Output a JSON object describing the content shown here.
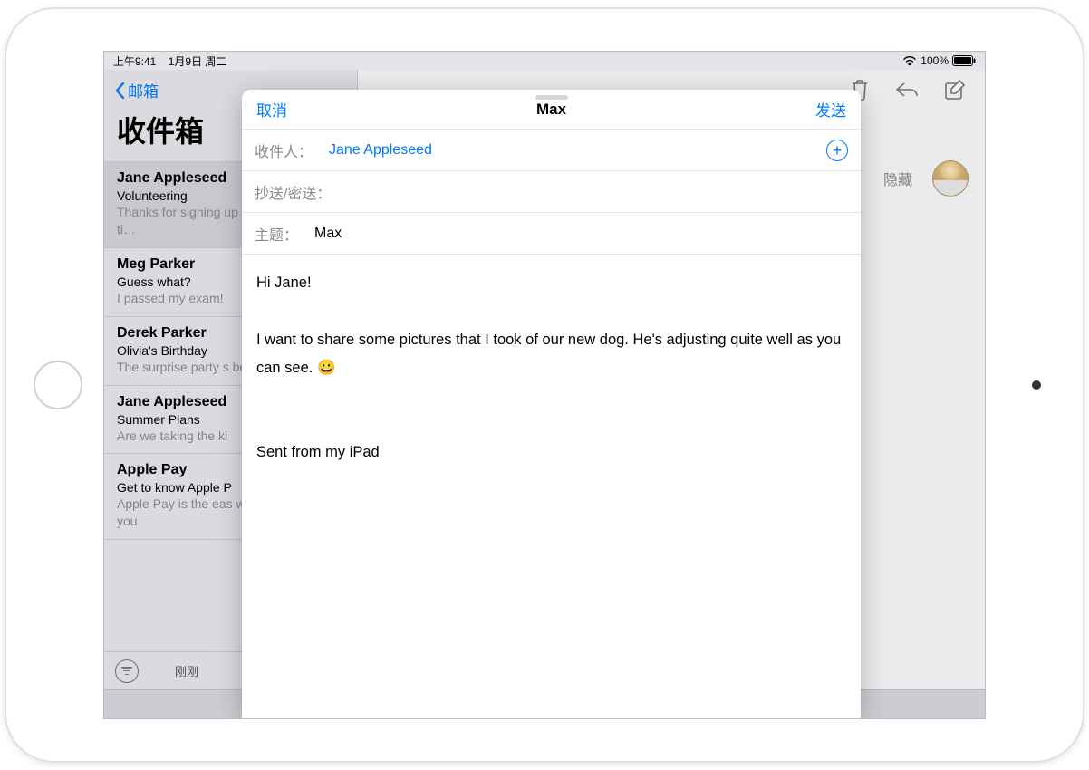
{
  "status": {
    "time": "上午9:41",
    "date": "1月9日 周二",
    "wifi": "wifi",
    "battery_pct": "100%"
  },
  "sidebar": {
    "back_label": "邮箱",
    "title": "收件箱",
    "items": [
      {
        "sender": "Jane Appleseed",
        "subject": "Volunteering",
        "preview": "Thanks for signing up appreciates your ti…"
      },
      {
        "sender": "Meg Parker",
        "subject": "Guess what?",
        "preview": "I passed my exam!"
      },
      {
        "sender": "Derek Parker",
        "subject": "Olivia's Birthday",
        "preview": "The surprise party s be late!"
      },
      {
        "sender": "Jane Appleseed",
        "subject": "Summer Plans",
        "preview": "Are we taking the ki"
      },
      {
        "sender": "Apple Pay",
        "subject": "Get to know Apple P",
        "preview": "Apple Pay is the eas with the devices you"
      }
    ],
    "footer_status": "刚刚"
  },
  "main": {
    "hide_label": "隐藏"
  },
  "compose": {
    "cancel": "取消",
    "title": "Max",
    "send": "发送",
    "to_label": "收件人：",
    "to_value": "Jane Appleseed",
    "cc_label": "抄送/密送：",
    "subject_label": "主题：",
    "subject_value": "Max",
    "body_line1": "Hi Jane!",
    "body_line2": "I want to share some pictures that I took of our new dog. He's adjusting quite well as you can see. 😀",
    "signature": "Sent from my iPad"
  }
}
